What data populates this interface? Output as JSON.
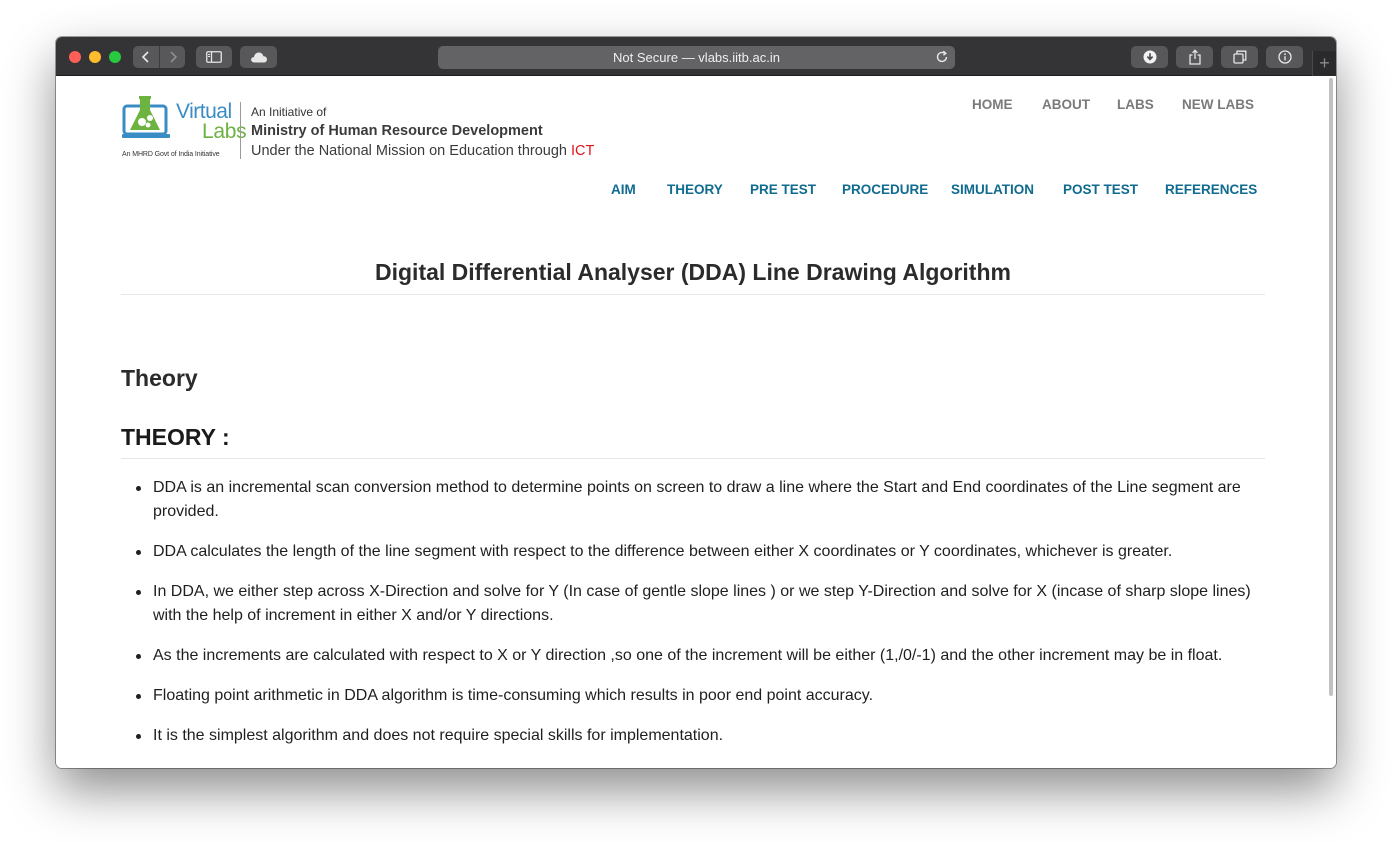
{
  "browser": {
    "url_text": "Not Secure — vlabs.iitb.ac.in",
    "new_tab_symbol": "+"
  },
  "header": {
    "logo": {
      "word1": "Virtual",
      "word2": "Labs",
      "tagline": "An MHRD Govt of India Initiative"
    },
    "initiative_line1": "An Initiative of",
    "initiative_line2": "Ministry of Human Resource Development",
    "initiative_line3": "Under the National Mission on Education through",
    "initiative_ict": "ICT",
    "top_nav": [
      "HOME",
      "ABOUT",
      "LABS",
      "NEW LABS"
    ],
    "sub_nav": [
      "AIM",
      "THEORY",
      "PRE TEST",
      "PROCEDURE",
      "SIMULATION",
      "POST TEST",
      "REFERENCES"
    ]
  },
  "main": {
    "experiment_title": "Digital Differential Analyser (DDA) Line Drawing Algorithm",
    "section_title": "Theory",
    "theory_heading": "THEORY :",
    "bullets": [
      "DDA is an incremental scan conversion method to determine points on screen to draw a line where the Start and End coordinates of the Line segment are provided.",
      "DDA calculates the length of the line segment with respect to the difference between either X coordinates or Y coordinates, whichever is greater.",
      "In DDA, we either step across X-Direction and solve for Y (In case of gentle slope lines ) or we step Y-Direction and solve for X (incase of sharp slope lines) with the help of increment in either X and/or Y directions.",
      "As the increments are calculated with respect to X or Y direction ,so one of the increment will be either (1,/0/-1) and the other increment may be in float.",
      "Floating point arithmetic in DDA algorithm is time-consuming which results in poor end point accuracy.",
      "It is the simplest algorithm and does not require special skills for implementation."
    ]
  },
  "colors": {
    "titlebar": "#343436",
    "nav_grey": "#7a7a7a",
    "nav_blue": "#0f6b8f",
    "ict_red": "#e3131b",
    "logo_blue": "#3a8cc4",
    "logo_green": "#6cb33f"
  }
}
